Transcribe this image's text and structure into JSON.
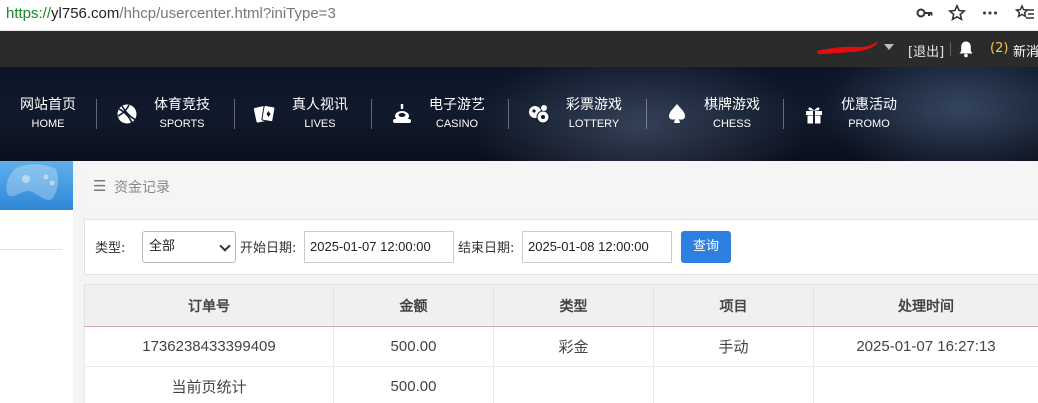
{
  "browser": {
    "url_scheme": "https://",
    "url_host": "yl756.com",
    "url_path": "/hhcp/usercenter.html?iniType=3",
    "icons": [
      "key-icon",
      "star-icon",
      "more-icon",
      "favorites-icon"
    ]
  },
  "user_bar": {
    "logout_label": "[退出]",
    "message_count": "(2)",
    "message_label": "新消"
  },
  "nav": [
    {
      "cn": "网站首页",
      "en": "HOME",
      "icon": "none"
    },
    {
      "cn": "体育竞技",
      "en": "SPORTS",
      "icon": "basketball-icon"
    },
    {
      "cn": "真人视讯",
      "en": "LIVES",
      "icon": "cards-icon"
    },
    {
      "cn": "电子游艺",
      "en": "CASINO",
      "icon": "slot-icon"
    },
    {
      "cn": "彩票游戏",
      "en": "LOTTERY",
      "icon": "lottery-balls-icon"
    },
    {
      "cn": "棋牌游戏",
      "en": "CHESS",
      "icon": "spade-icon"
    },
    {
      "cn": "优惠活动",
      "en": "PROMO",
      "icon": "gift-icon"
    }
  ],
  "breadcrumb": {
    "label": "资金记录"
  },
  "filter": {
    "type_label": "类型:",
    "type_value": "全部",
    "start_label": "开始日期:",
    "start_value": "2025-01-07 12:00:00",
    "end_label": "结束日期:",
    "end_value": "2025-01-08 12:00:00",
    "query_label": "查询"
  },
  "table": {
    "headers": [
      "订单号",
      "金额",
      "类型",
      "项目",
      "处理时间"
    ],
    "rows": [
      [
        "1736238433399409",
        "500.00",
        "彩金",
        "手动",
        "2025-01-07 16:27:13"
      ],
      [
        "当前页统计",
        "500.00",
        "",
        "",
        ""
      ]
    ]
  },
  "colors": {
    "accent": "#2d7fe0",
    "topbar": "#2b2b2b",
    "message_count": "#f2c94c"
  }
}
